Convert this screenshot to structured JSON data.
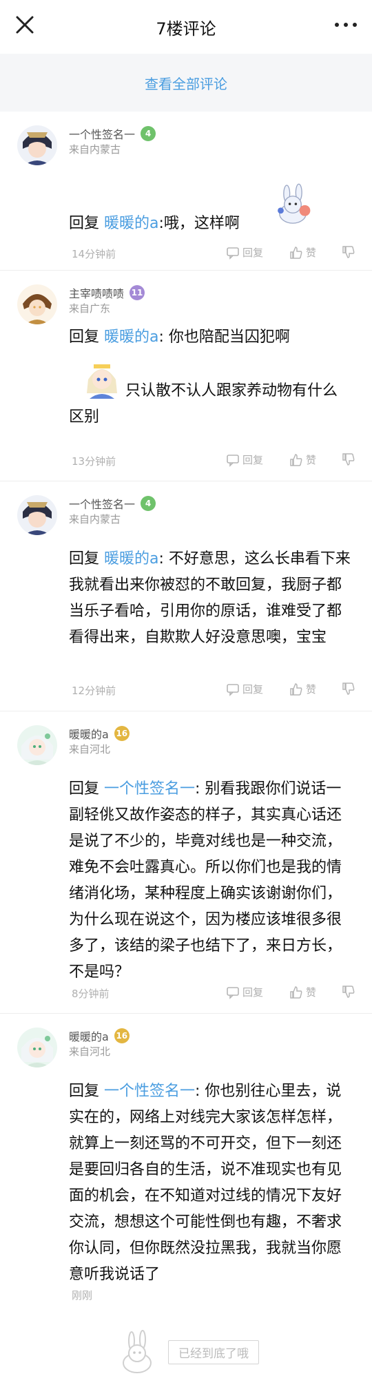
{
  "header": {
    "title": "7楼评论"
  },
  "viewall": {
    "label": "查看全部评论"
  },
  "actions": {
    "reply": "回复",
    "like": "赞"
  },
  "colors": {
    "accent": "#4a9de0",
    "level_green": "#6fc26b",
    "level_purple": "#a48ad6",
    "level_gold": "#e3b641"
  },
  "comments": [
    {
      "user": "一个性签名一",
      "level": "4",
      "location": "来自内蒙古",
      "prefix": "回复 ",
      "mention": "暖暖的a",
      "text": ":哦，这样啊",
      "time": "14分钟前"
    },
    {
      "user": "主宰啧啧啧",
      "level": "11",
      "location": "来自广东",
      "prefix": "回复 ",
      "mention": "暖暖的a",
      "text": ": 你也陪配当囚犯啊",
      "text2": "只认散不认人跟家养动物有什么区别",
      "time": "13分钟前"
    },
    {
      "user": "一个性签名一",
      "level": "4",
      "location": "来自内蒙古",
      "prefix": "回复 ",
      "mention": "暖暖的a",
      "text": ": 不好意思，这么长串看下来我就看出来你被怼的不敢回复，我厨子都当乐子看哈，引用你的原话，谁难受了都看得出来，自欺欺人好没意思噢，宝宝",
      "time": "12分钟前"
    },
    {
      "user": "暖暖的a",
      "level": "16",
      "location": "来自河北",
      "prefix": "回复 ",
      "mention": "一个性签名一",
      "text": ": 别看我跟你们说话一副轻佻又故作姿态的样子，其实真心话还是说了不少的，毕竟对线也是一种交流，难免不会吐露真心。所以你们也是我的情绪消化场，某种程度上确实该谢谢你们，为什么现在说这个，因为楼应该堆很多很多了，该结的梁子也结下了，来日方长，不是吗？",
      "time": "8分钟前"
    },
    {
      "user": "暖暖的a",
      "level": "16",
      "location": "来自河北",
      "prefix": "回复 ",
      "mention": "一个性签名一",
      "text": ": 你也别往心里去，说实在的，网络上对线完大家该怎样怎样，就算上一刻还骂的不可开交，但下一刻还是要回归各自的生活，说不准现实也有见面的机会，在不知道对过线的情况下友好交流，想想这个可能性倒也有趣，不奢求你认同，但你既然没拉黑我，我就当你愿意听我说话了",
      "time": "刚刚"
    }
  ],
  "footer": {
    "end_text": "已经到底了哦"
  }
}
